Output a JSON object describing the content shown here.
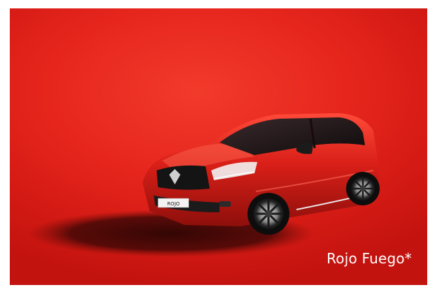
{
  "hero": {
    "color_name": "Rojo Fuego*",
    "plate_text": "ROJO",
    "background_color": "#e6261d",
    "car_color": "#d5211a"
  }
}
